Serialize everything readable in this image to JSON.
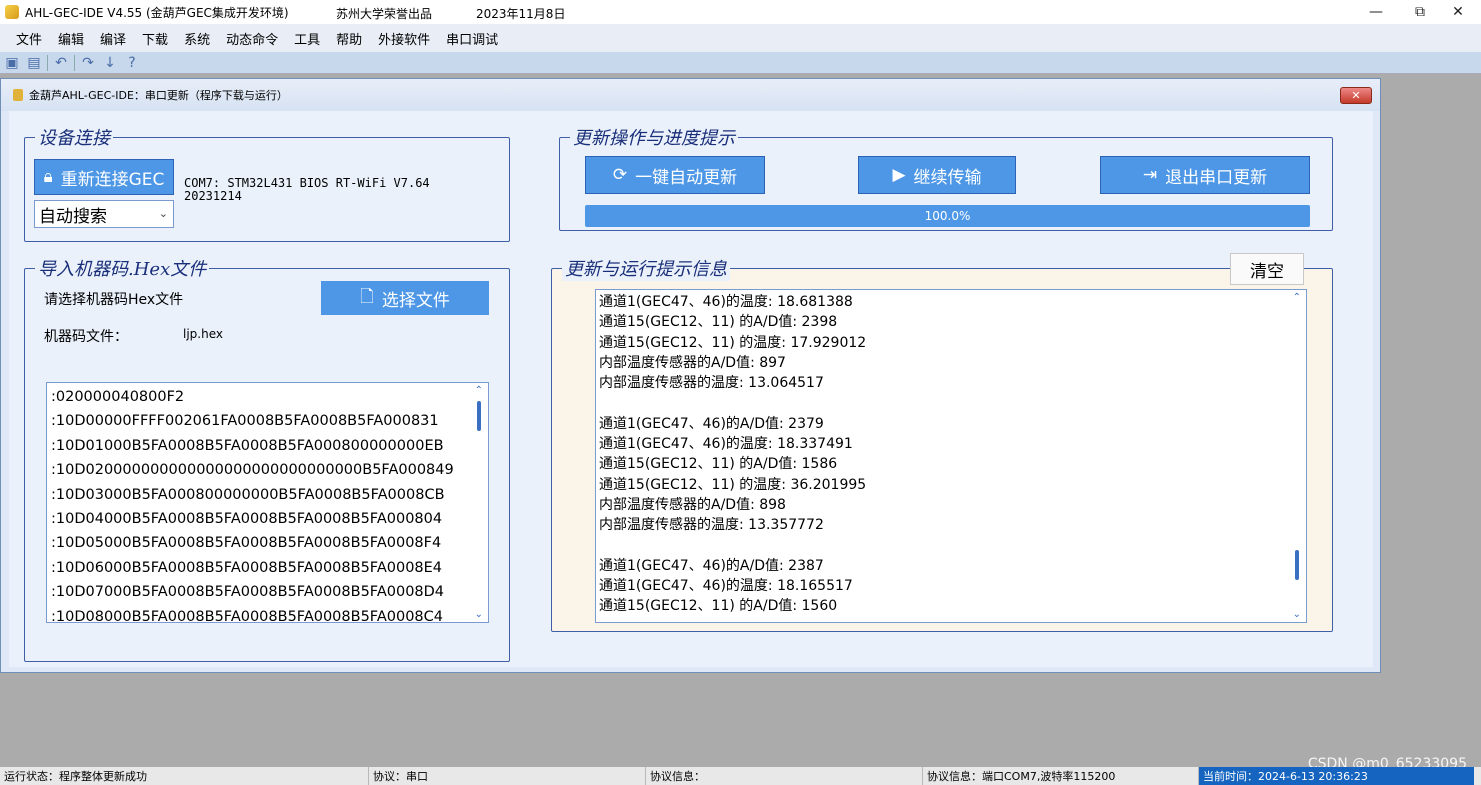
{
  "window": {
    "title": "AHL-GEC-IDE V4.55  (金葫芦GEC集成开发环境)",
    "subtitle": "苏州大学荣誉出品",
    "date": "2023年11月8日",
    "minimize": "—",
    "maximize": "⧉",
    "close": "✕"
  },
  "menu": [
    "文件",
    "编辑",
    "编译",
    "下载",
    "系统",
    "动态命令",
    "工具",
    "帮助",
    "外接软件",
    "串口调试"
  ],
  "dialog": {
    "title": "金葫芦AHL-GEC-IDE：串口更新（程序下载与运行）",
    "close": "✕"
  },
  "device": {
    "group_title": "设备连接",
    "reconnect_label": "重新连接GEC",
    "info_line1": "COM7:  STM32L431 BIOS RT-WiFi V7.64",
    "info_line2": "20231214",
    "search_mode": "自动搜索"
  },
  "update": {
    "group_title": "更新操作与进度提示",
    "auto_update_label": "一键自动更新",
    "continue_label": "继续传输",
    "exit_label": "退出串口更新",
    "progress_text": "100.0%",
    "progress_fraction": 1.0
  },
  "hex": {
    "group_title": "导入机器码.Hex文件",
    "prompt": "请选择机器码Hex文件",
    "select_label": "选择文件",
    "file_label": "机器码文件：",
    "file_name": "ljp.hex",
    "lines": [
      ":020000040800F2",
      ":10D00000FFFF002061FA0008B5FA0008B5FA000831",
      ":10D01000B5FA0008B5FA0008B5FA000800000000EB",
      ":10D020000000000000000000000000000B5FA000849",
      ":10D03000B5FA000800000000B5FA0008B5FA0008CB",
      ":10D04000B5FA0008B5FA0008B5FA0008B5FA000804",
      ":10D05000B5FA0008B5FA0008B5FA0008B5FA0008F4",
      ":10D06000B5FA0008B5FA0008B5FA0008B5FA0008E4",
      ":10D07000B5FA0008B5FA0008B5FA0008B5FA0008D4",
      ":10D08000B5FA0008B5FA0008B5FA0008B5FA0008C4"
    ]
  },
  "info": {
    "group_title": "更新与运行提示信息",
    "clear_label": "清空",
    "lines": [
      "通道1(GEC47、46)的温度:  18.681388",
      "通道15(GEC12、11) 的A/D值: 2398",
      "通道15(GEC12、11) 的温度: 17.929012",
      "内部温度传感器的A/D值: 897",
      "内部温度传感器的温度: 13.064517",
      "",
      "通道1(GEC47、46)的A/D值:  2379",
      "通道1(GEC47、46)的温度:  18.337491",
      "通道15(GEC12、11) 的A/D值: 1586",
      "通道15(GEC12、11) 的温度: 36.201995",
      "内部温度传感器的A/D值: 898",
      "内部温度传感器的温度: 13.357772",
      "",
      "通道1(GEC47、46)的A/D值:  2387",
      "通道1(GEC47、46)的温度:  18.165517",
      "通道15(GEC12、11) 的A/D值: 1560"
    ]
  },
  "status": {
    "run_state": "运行状态：程序整体更新成功",
    "protocol": "协议：串口",
    "protocol_info": "协议信息：",
    "port_info": "协议信息：端口COM7,波特率115200",
    "current_time": "当前时间：2024-6-13 20:36:23"
  },
  "watermark": "CSDN @m0_65233095",
  "colors": {
    "accent_button": "#4d97e6",
    "group_border": "#3e5fa8",
    "status_active": "#1565c0"
  }
}
